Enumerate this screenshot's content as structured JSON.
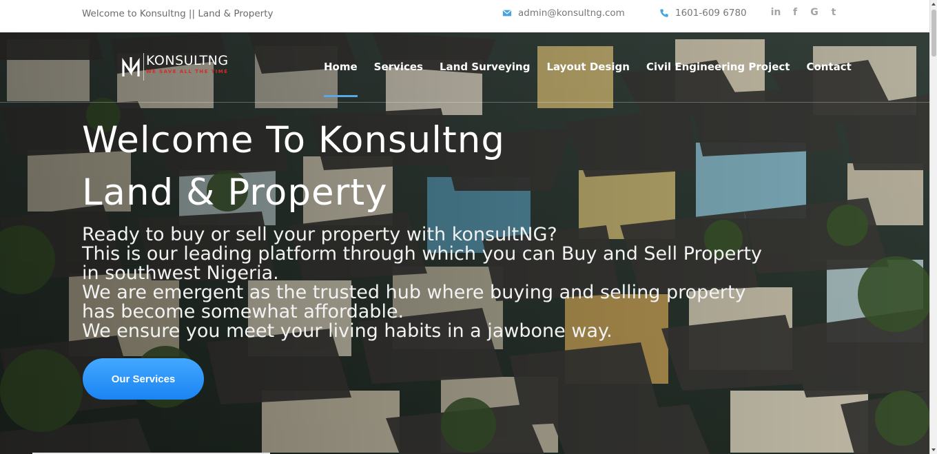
{
  "topbar": {
    "welcome": "Welcome to Konsultng || Land & Property",
    "email": "admin@konsultng.com",
    "phone": "1601-609 6780",
    "social": [
      {
        "icon": "linkedin-icon",
        "glyph": "in"
      },
      {
        "icon": "facebook-icon",
        "glyph": "f"
      },
      {
        "icon": "google-icon",
        "glyph": "G"
      },
      {
        "icon": "twitter-icon",
        "glyph": "t"
      }
    ]
  },
  "logo": {
    "name": "KONSULTNG",
    "tagline": "WE SAVE ALL THE TIME"
  },
  "nav": {
    "items": [
      "Home",
      "Services",
      "Land Surveying",
      "Layout Design",
      "Civil Engineering Project",
      "Contact"
    ],
    "active": "Home"
  },
  "hero": {
    "title_line1": "Welcome To Konsultng",
    "title_line2": "Land & Property",
    "lead": [
      "Ready to buy or sell your property with konsultNG?",
      "This is our leading platform through which you can Buy and Sell Property",
      "in southwest Nigeria.",
      "We are emergent as the trusted hub where buying and selling property",
      "has become somewhat affordable.",
      "We ensure you meet your living habits in a jawbone way."
    ],
    "cta_label": "Our Services"
  },
  "colors": {
    "accent": "#2594f6",
    "active_underline": "#5aa7e8",
    "logo_red": "#d42a2a",
    "topbar_icon": "#4aa3df"
  }
}
